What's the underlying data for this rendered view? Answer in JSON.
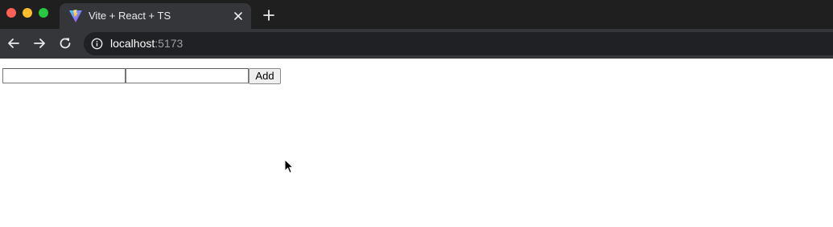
{
  "browser": {
    "tab": {
      "title": "Vite + React + TS",
      "favicon": "vite-logo-icon",
      "close_icon": "close-icon"
    },
    "new_tab_icon": "plus-icon",
    "toolbar": {
      "back_icon": "arrow-left-icon",
      "forward_icon": "arrow-right-icon",
      "reload_icon": "reload-icon",
      "info_icon": "info-icon",
      "url_host": "localhost",
      "url_port": ":5173"
    },
    "colors": {
      "tabstrip": "#1f1f1f",
      "toolbar": "#35363a",
      "omnibox": "#202124",
      "close": "#ff5f57",
      "minimize": "#febc2e",
      "maximize": "#28c840"
    }
  },
  "page": {
    "input_1": {
      "value": "",
      "placeholder": ""
    },
    "input_2": {
      "value": "",
      "placeholder": ""
    },
    "add_button_label": "Add",
    "cursor_icon": "mouse-pointer-icon"
  }
}
